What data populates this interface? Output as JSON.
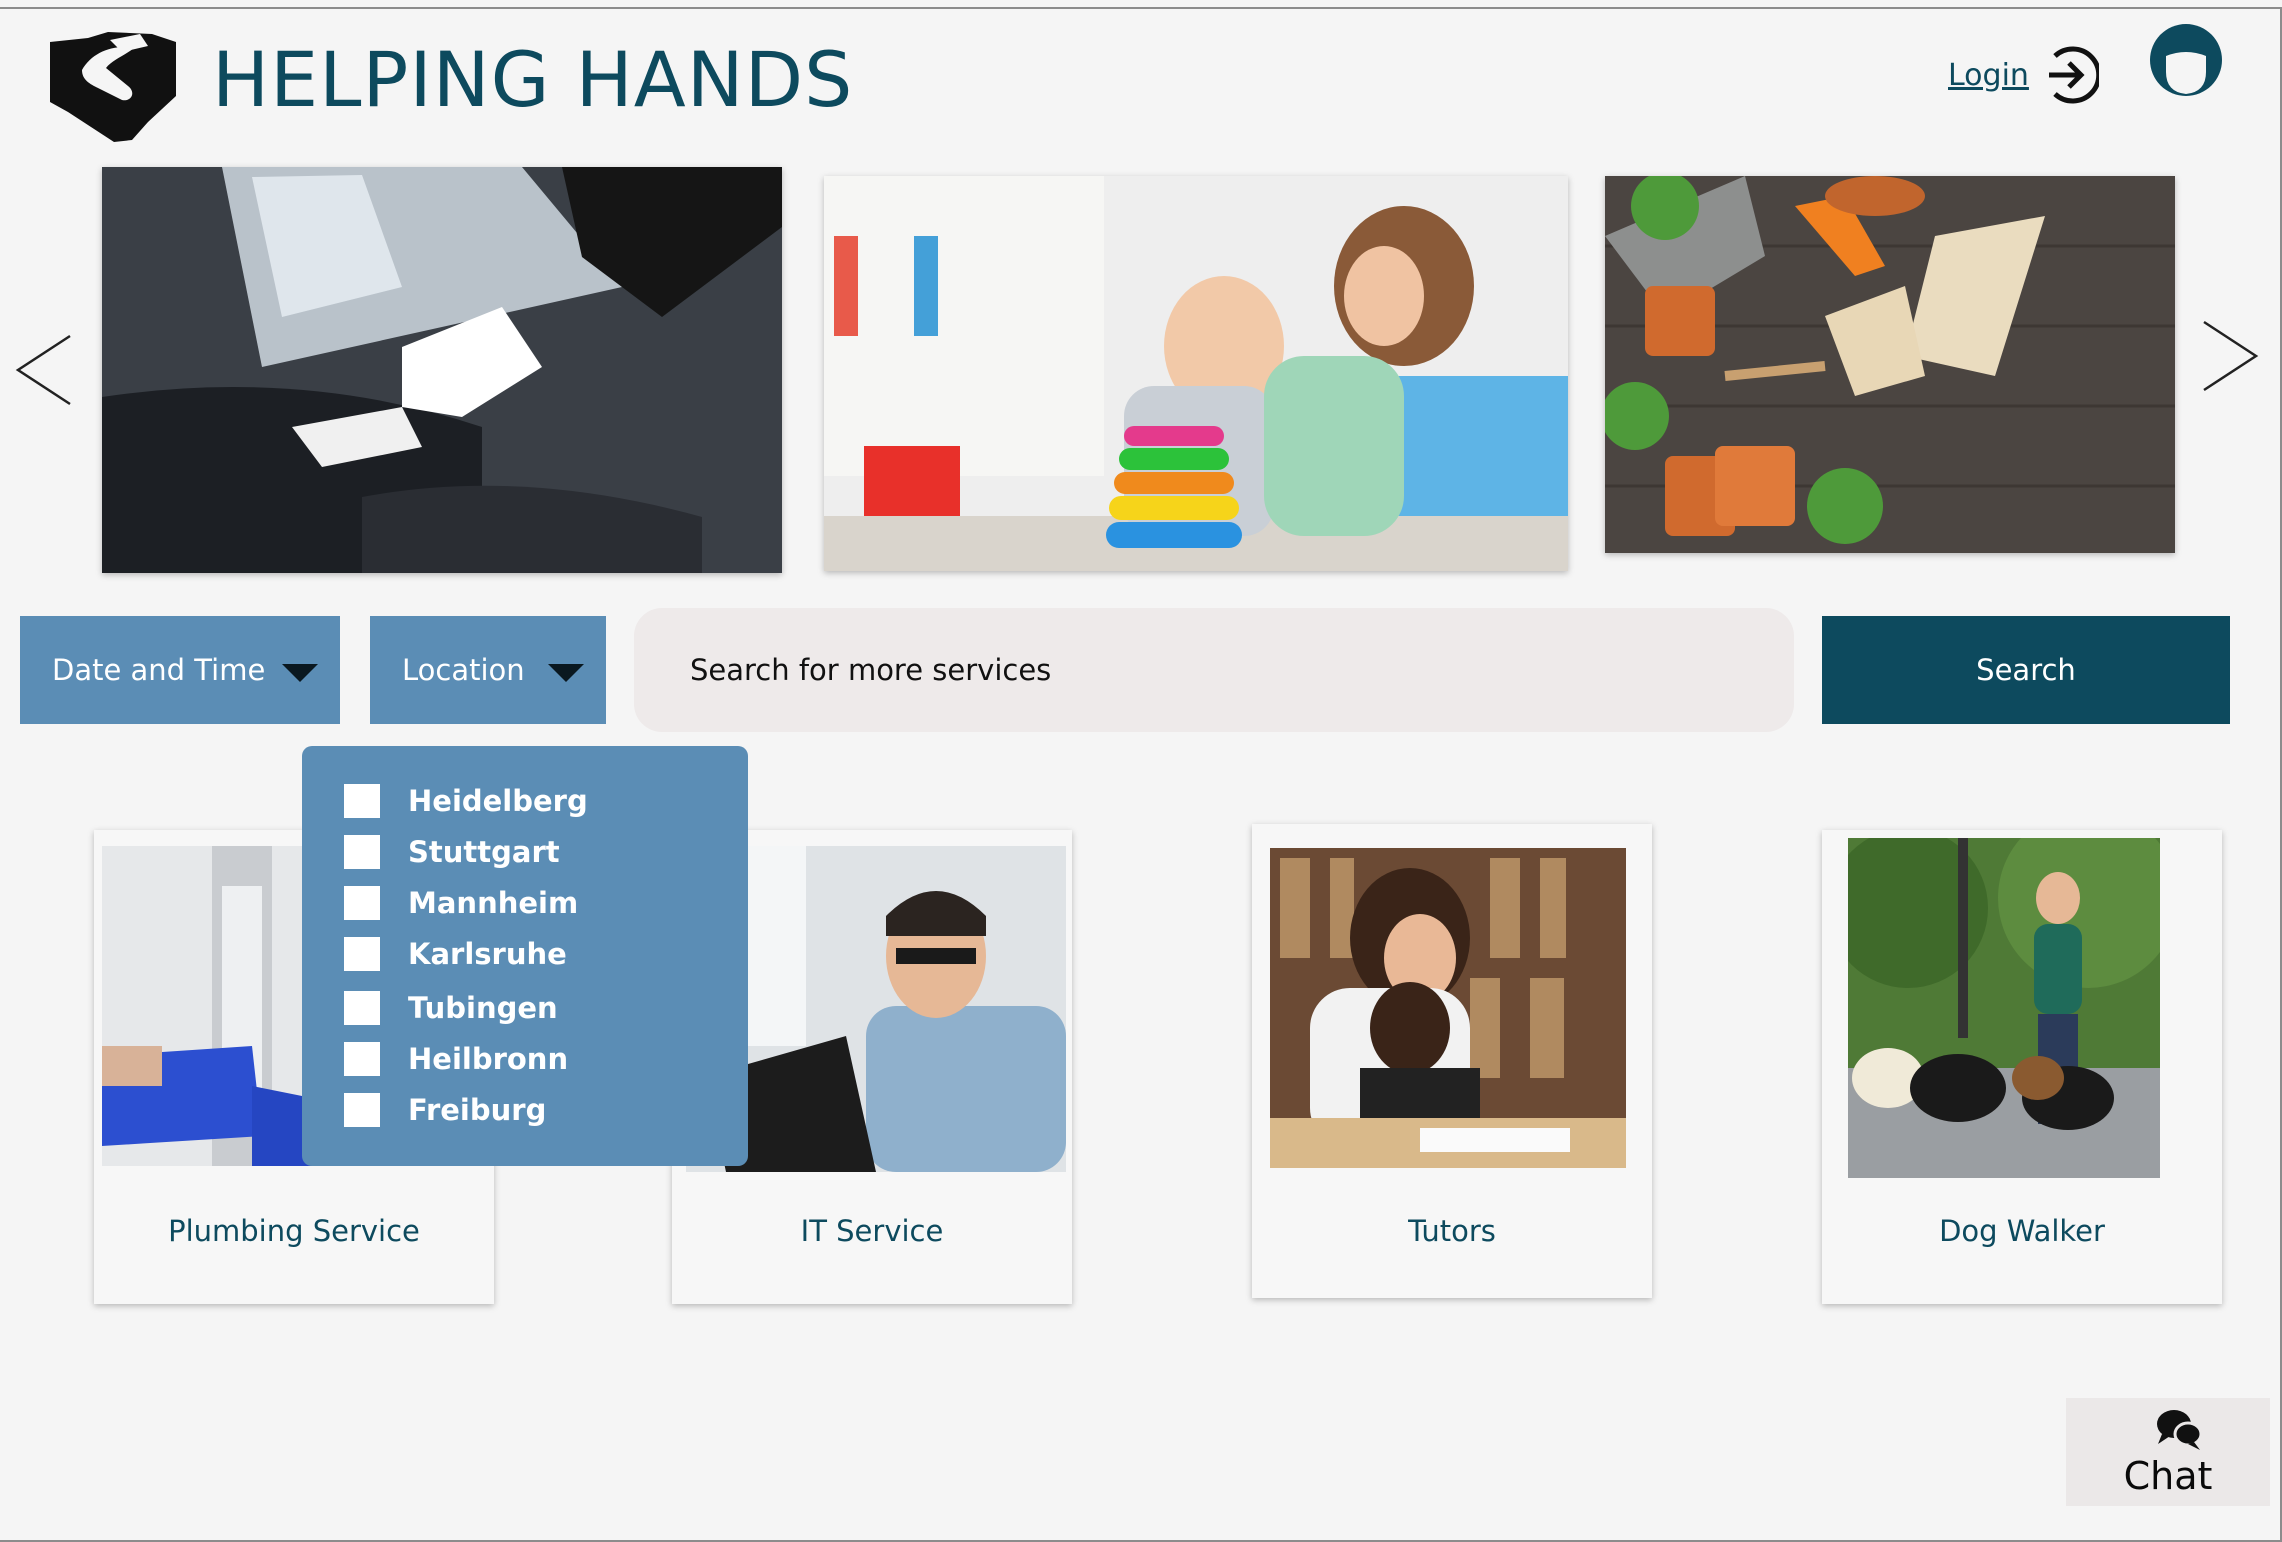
{
  "header": {
    "brand": "HELPING HANDS",
    "login_label": "Login",
    "icons": [
      "handshake-icon",
      "login-arrow-icon",
      "user-avatar-icon"
    ]
  },
  "carousel": {
    "slides": [
      "chauffeur",
      "childcare",
      "gardening"
    ],
    "icons": [
      "chevron-left-icon",
      "chevron-right-icon"
    ]
  },
  "filters": {
    "date_time_label": "Date and Time",
    "location_label": "Location",
    "search_placeholder": "Search for more services",
    "search_button": "Search",
    "location_options": [
      {
        "label": "Heidelberg",
        "checked": false
      },
      {
        "label": "Stuttgart",
        "checked": false
      },
      {
        "label": "Mannheim",
        "checked": false
      },
      {
        "label": "Karlsruhe",
        "checked": false
      },
      {
        "label": "Tubingen",
        "checked": false
      },
      {
        "label": "Heilbronn",
        "checked": false
      },
      {
        "label": "Freiburg",
        "checked": false
      }
    ]
  },
  "services": [
    {
      "label": "Plumbing Service"
    },
    {
      "label": "IT Service"
    },
    {
      "label": "Tutors"
    },
    {
      "label": "Dog Walker"
    }
  ],
  "chat": {
    "label": "Chat",
    "icon": "chat-bubbles-icon"
  },
  "colors": {
    "primary": "#0d4a5e",
    "accent": "#5b8db5",
    "background": "#f5f5f5"
  }
}
